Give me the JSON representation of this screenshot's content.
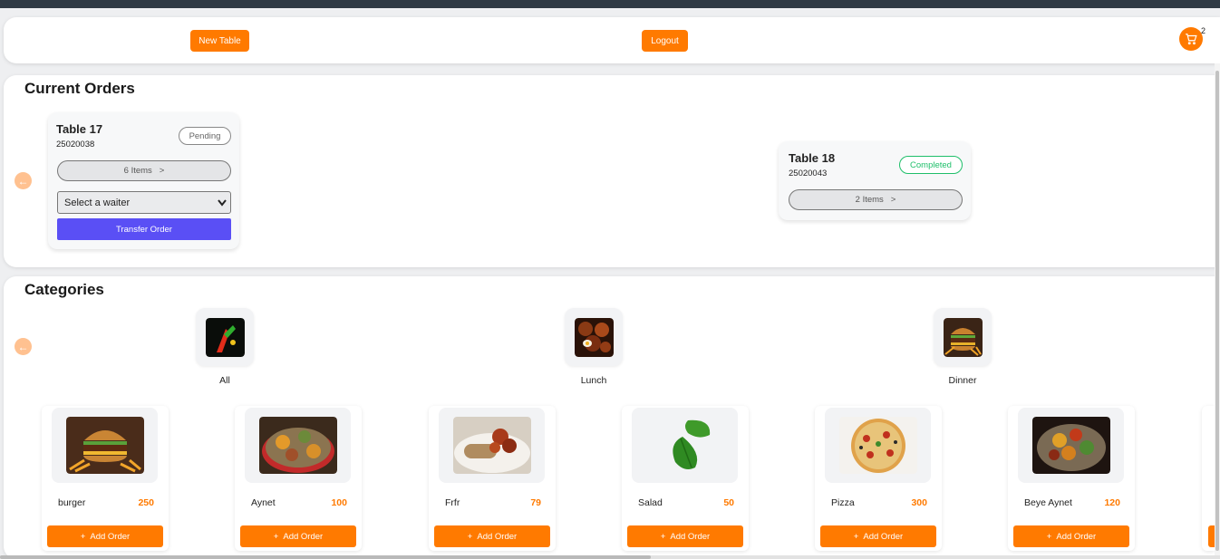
{
  "header": {
    "new_table_label": "New Table",
    "logout_label": "Logout",
    "cart_count": "2",
    "cart_icon": "cart-icon"
  },
  "current_orders": {
    "title": "Current Orders",
    "orders": [
      {
        "table": "Table 17",
        "id": "25020038",
        "status": "Pending",
        "status_color": "#888888",
        "items_label": "6 Items",
        "waiter_select": "Select a waiter",
        "transfer_label": "Transfer Order"
      },
      {
        "table": "Table 18",
        "id": "25020043",
        "status": "Completed",
        "status_color": "#1fbf6a",
        "items_label": "2 Items"
      }
    ]
  },
  "categories": {
    "title": "Categories",
    "items": [
      {
        "label": "All"
      },
      {
        "label": "Lunch"
      },
      {
        "label": "Dinner"
      }
    ]
  },
  "menu": {
    "add_label": "Add Order",
    "items": [
      {
        "name": "burger",
        "price": "250"
      },
      {
        "name": "Aynet",
        "price": "100"
      },
      {
        "name": "Frfr",
        "price": "79"
      },
      {
        "name": "Salad",
        "price": "50"
      },
      {
        "name": "Pizza",
        "price": "300"
      },
      {
        "name": "Beye Aynet",
        "price": "120"
      }
    ]
  },
  "colors": {
    "accent": "#ff7a00",
    "transfer": "#5a4ff5"
  }
}
